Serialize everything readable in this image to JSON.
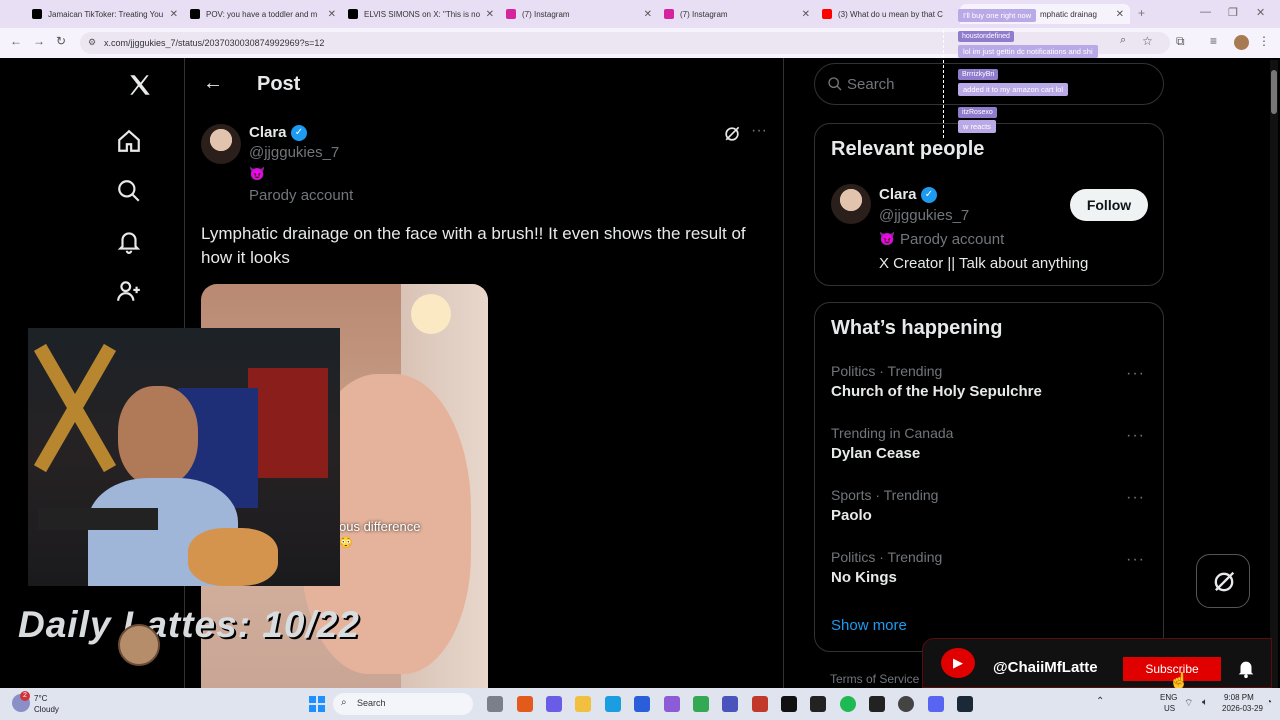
{
  "browser": {
    "tabs": [
      {
        "title": "Jamaican TikToker: Treating You",
        "icon_color": "#000000"
      },
      {
        "title": "POV: you have a toddler and m",
        "icon_color": "#000000"
      },
      {
        "title": "ELVIS SIMONS on X: \"This is no",
        "icon_color": "#000000"
      },
      {
        "title": "(7) Instagram",
        "icon_color": "#d6249f"
      },
      {
        "title": "(7) Instagram",
        "icon_color": "#d6249f"
      },
      {
        "title": "(3) What do u mean by that C",
        "icon_color": "#ff0000"
      },
      {
        "title": "mphatic drainag",
        "icon_color": "#000000"
      }
    ],
    "url": "x.com/jjggukies_7/status/2037030030874992969?s=12",
    "new_tab": "+"
  },
  "sidebar": {
    "logo": "x-logo-icon",
    "items": [
      "home-icon",
      "search-icon",
      "notifications-icon",
      "follow-icon"
    ]
  },
  "main": {
    "header_title": "Post",
    "author": {
      "name": "Clara",
      "handle": "@jjggukies_7",
      "emoji": "😈",
      "label": "Parody account"
    },
    "post_text": "Lymphatic drainage on the face with a brush!! It even shows the result of how it looks",
    "video_caption": "ous difference",
    "video_emoji": "😳"
  },
  "right": {
    "search_placeholder": "Search",
    "relevant": {
      "title": "Relevant people",
      "name": "Clara",
      "handle": "@jjggukies_7",
      "label": "Parody account",
      "emoji": "😈",
      "bio": "X Creator || Talk about anything",
      "follow_label": "Follow"
    },
    "happening": {
      "title": "What’s happening",
      "trends": [
        {
          "category": "Politics · Trending",
          "name": "Church of the Holy Sepulchre"
        },
        {
          "category": "Trending in Canada",
          "name": "Dylan Cease"
        },
        {
          "category": "Sports · Trending",
          "name": "Paolo"
        },
        {
          "category": "Politics · Trending",
          "name": "No Kings"
        }
      ],
      "show_more": "Show more"
    },
    "footer": "Terms of Service"
  },
  "chat": [
    {
      "user": "BrrrizkyBri",
      "msg": "I'll buy one right now"
    },
    {
      "user": "houstondefined",
      "msg": "lol im just gettin dc notifications and shi"
    },
    {
      "user": "BrrrizkyBri",
      "msg": "added it to my amazon cart lol"
    },
    {
      "user": "itzRosexo",
      "msg": "w reacts"
    }
  ],
  "overlay": {
    "daily_text": "Daily Lattes: 10/22",
    "channel_handle": "@ChaiiMfLatte",
    "subscribe_label": "Subscribe",
    "accent": "#e00000"
  },
  "taskbar": {
    "weather_temp": "7°C",
    "weather_desc": "Cloudy",
    "search_label": "Search",
    "lang_top": "ENG",
    "lang_bottom": "US",
    "time": "9:08 PM",
    "date": "2026-03-29",
    "notif_count": "2"
  },
  "colors": {
    "x_blue": "#1d9bf0",
    "verified": "#1d9bf0",
    "chat_badge": "#8f7ccc"
  }
}
